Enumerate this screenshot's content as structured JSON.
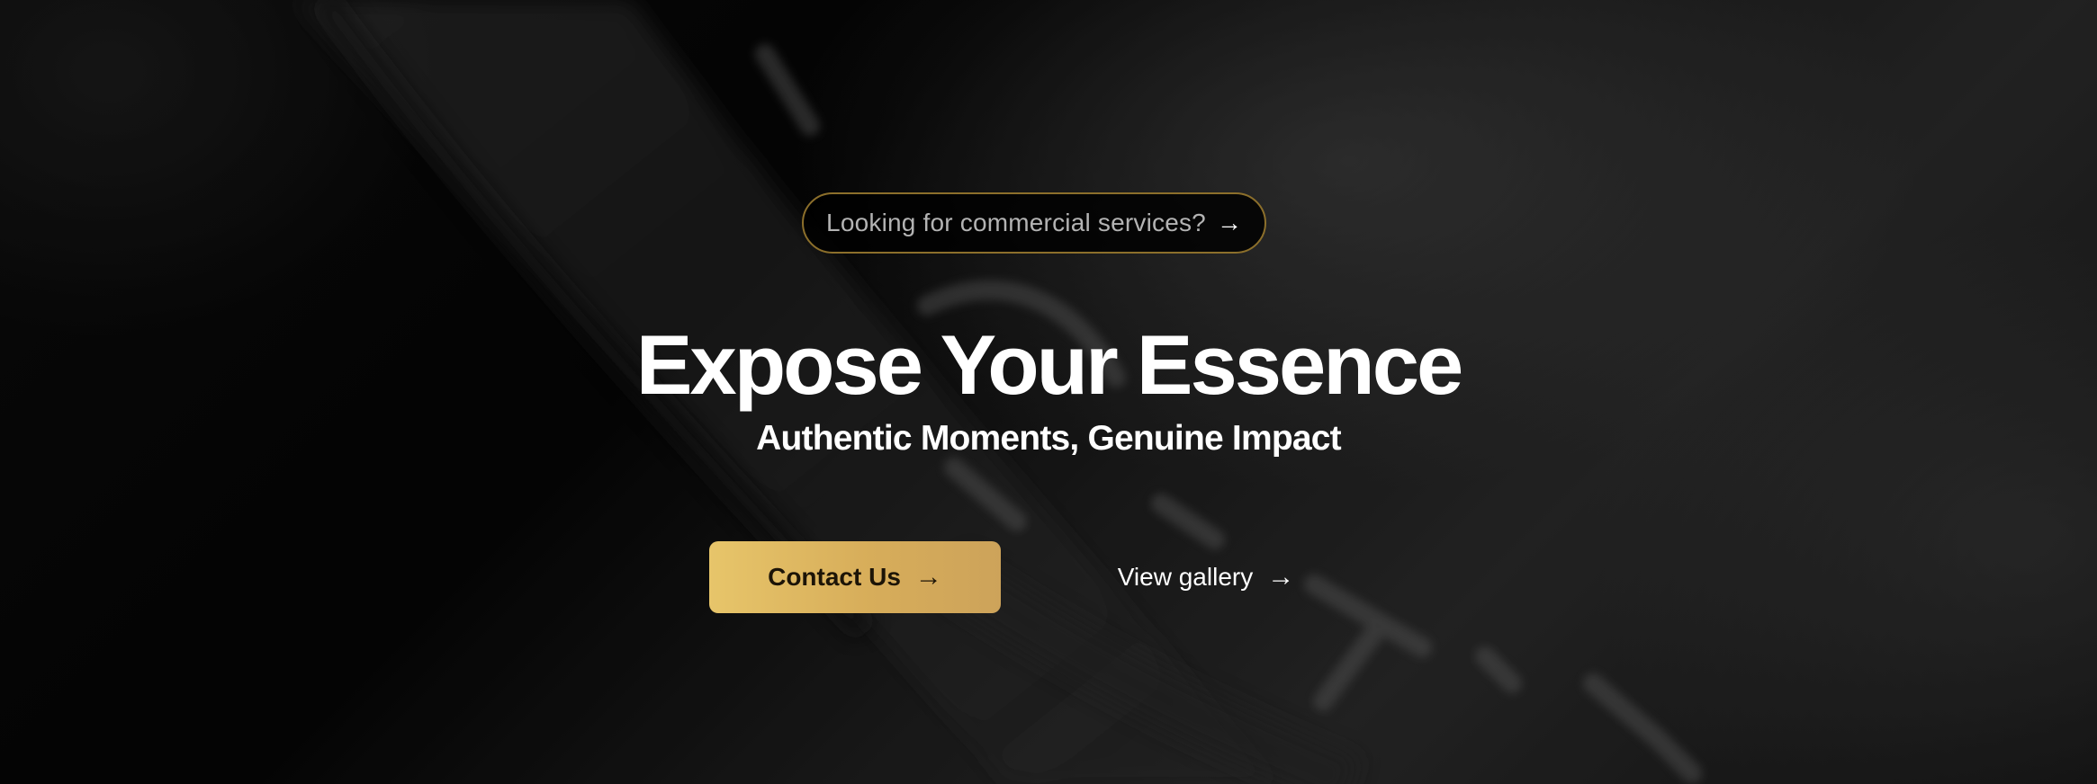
{
  "announcement": {
    "text": "Looking for commercial services?",
    "icon": "arrow-right-icon"
  },
  "hero": {
    "title": "Expose Your Essence",
    "subtitle": "Authentic Moments, Genuine Impact"
  },
  "actions": {
    "contact_label": "Contact Us",
    "contact_icon": "arrow-right-icon",
    "gallery_label": "View gallery",
    "gallery_icon": "arrow-right-icon"
  },
  "colors": {
    "accent_gold": "#d9b25f",
    "pill_border": "#8c6f2b",
    "background": "#000000",
    "text": "#ffffff"
  }
}
